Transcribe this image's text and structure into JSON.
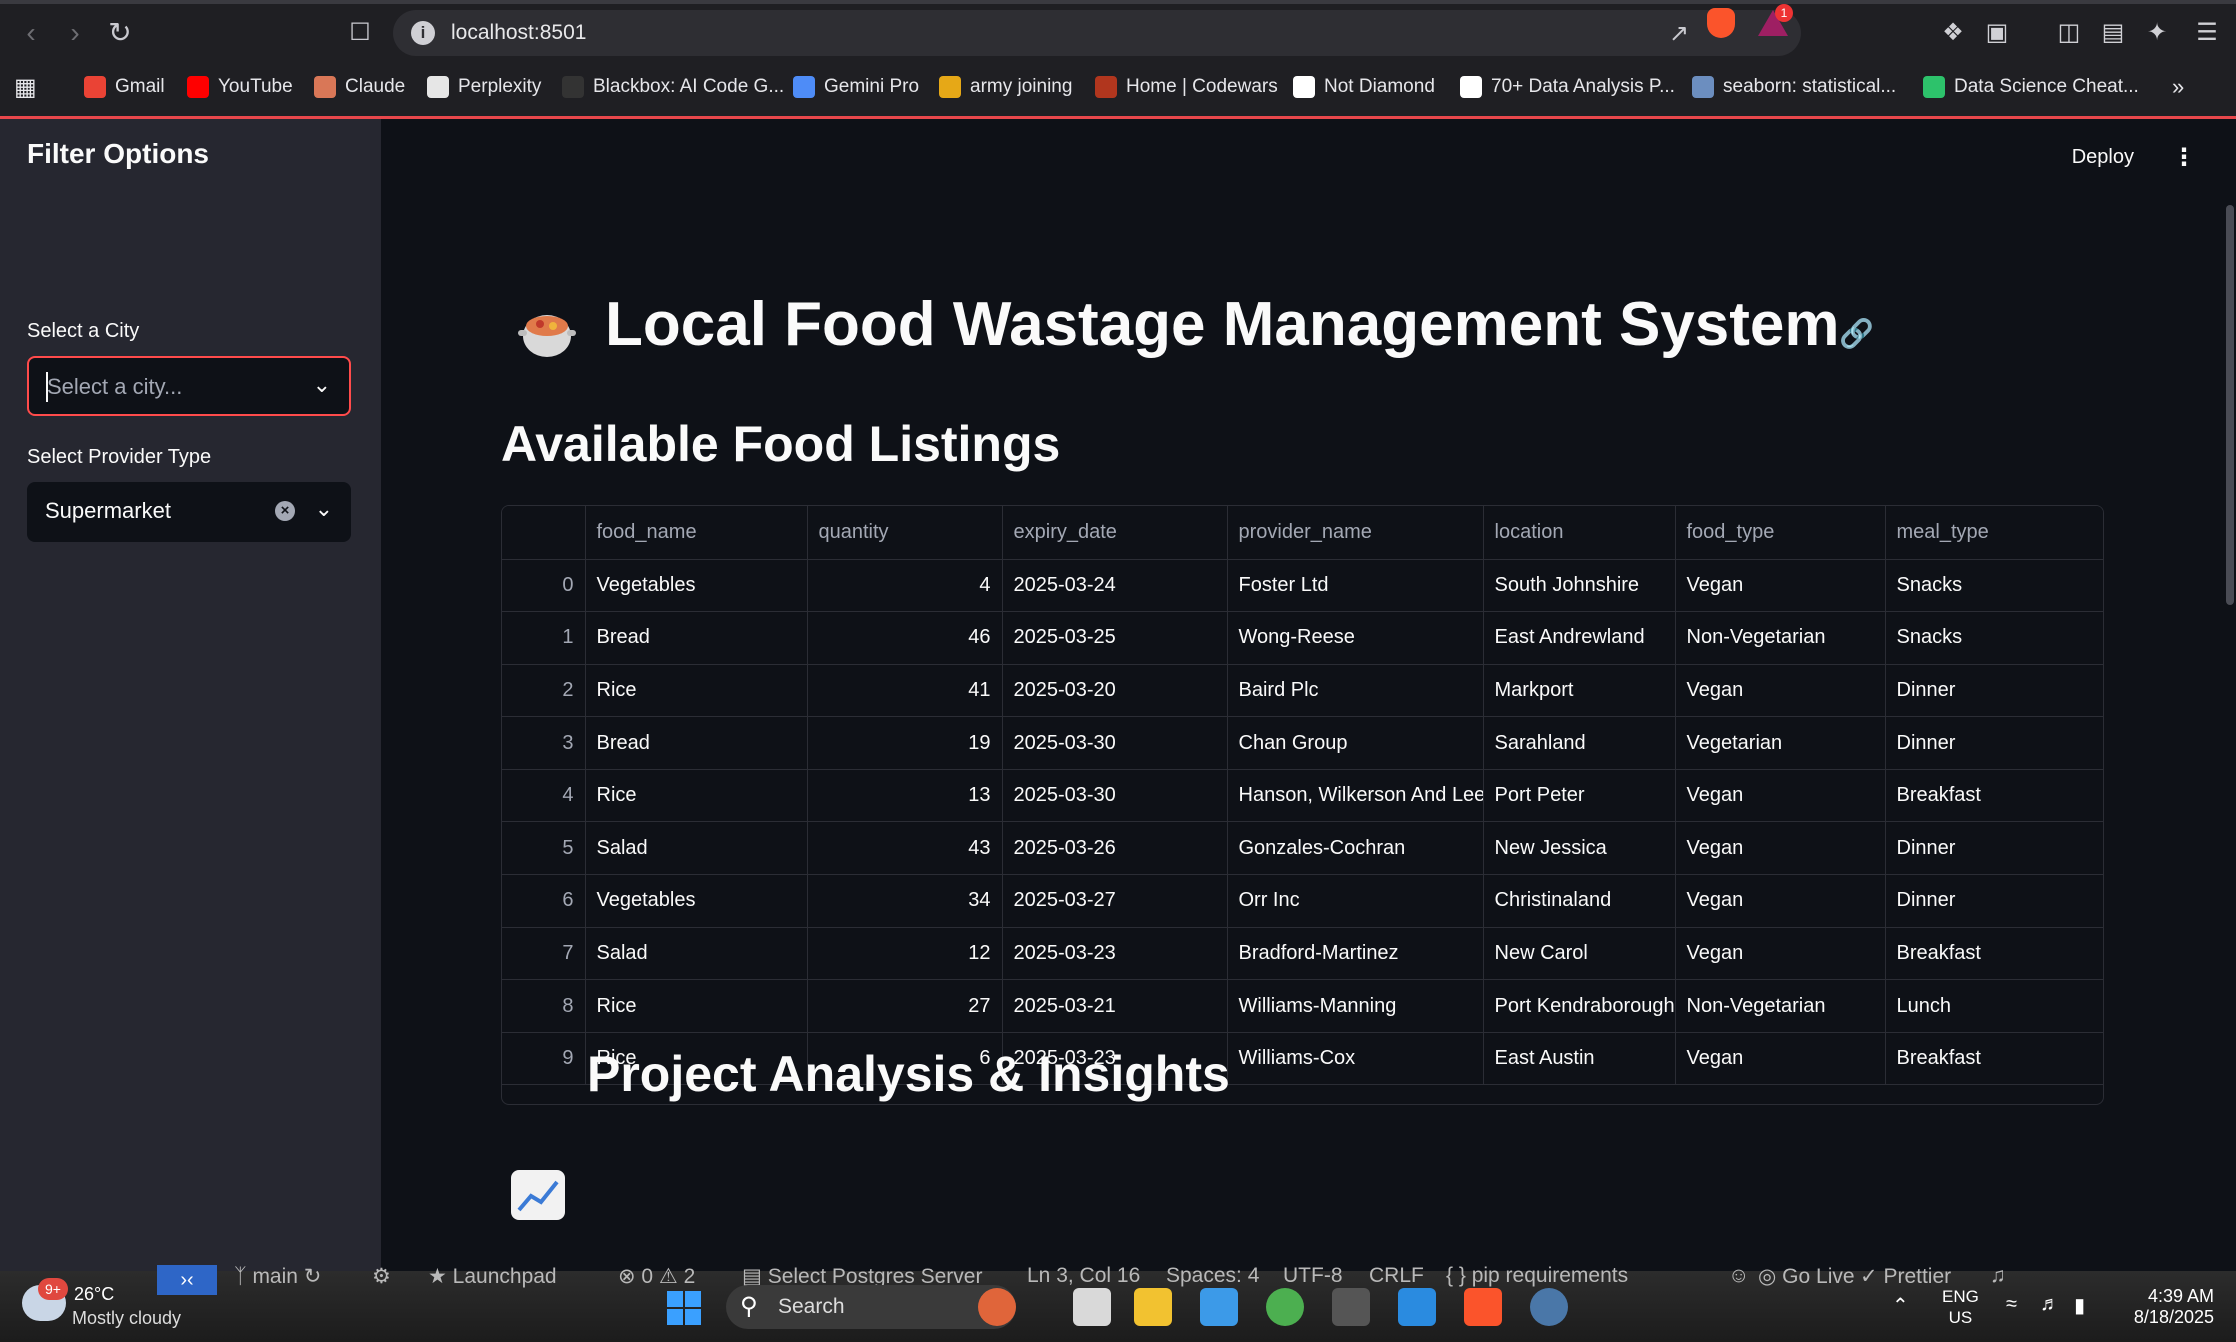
{
  "browser": {
    "url": "localhost:8501",
    "notification_count": "1",
    "bookmarks": [
      {
        "label": "Gmail",
        "color": "#ea4335"
      },
      {
        "label": "YouTube",
        "color": "#ff0000"
      },
      {
        "label": "Claude",
        "color": "#d97757"
      },
      {
        "label": "Perplexity",
        "color": "#e6e6e6"
      },
      {
        "label": "Blackbox: AI Code G...",
        "color": "#333333"
      },
      {
        "label": "Gemini Pro",
        "color": "#4e8cf7"
      },
      {
        "label": "army joining",
        "color": "#e6a817"
      },
      {
        "label": "Home | Codewars",
        "color": "#b1361e"
      },
      {
        "label": "Not Diamond",
        "color": "#ffffff"
      },
      {
        "label": "70+ Data Analysis P...",
        "color": "#ffffff"
      },
      {
        "label": "seaborn: statistical...",
        "color": "#6c8ebf"
      },
      {
        "label": "Data Science Cheat...",
        "color": "#2dc26b"
      }
    ]
  },
  "sidebar": {
    "title": "Filter Options",
    "city_label": "Select a City",
    "city_placeholder": "Select a city...",
    "provider_label": "Select Provider Type",
    "provider_value": "Supermarket"
  },
  "header": {
    "deploy_label": "Deploy"
  },
  "main": {
    "title": "Local Food Wastage Management System",
    "listings_heading": "Available Food Listings",
    "analysis_heading": "Project Analysis & Insights"
  },
  "table": {
    "columns": [
      "",
      "food_name",
      "quantity",
      "expiry_date",
      "provider_name",
      "location",
      "food_type",
      "meal_type"
    ],
    "rows": [
      [
        "0",
        "Vegetables",
        "4",
        "2025-03-24",
        "Foster Ltd",
        "South Johnshire",
        "Vegan",
        "Snacks"
      ],
      [
        "1",
        "Bread",
        "46",
        "2025-03-25",
        "Wong-Reese",
        "East Andrewland",
        "Non-Vegetarian",
        "Snacks"
      ],
      [
        "2",
        "Rice",
        "41",
        "2025-03-20",
        "Baird Plc",
        "Markport",
        "Vegan",
        "Dinner"
      ],
      [
        "3",
        "Bread",
        "19",
        "2025-03-30",
        "Chan Group",
        "Sarahland",
        "Vegetarian",
        "Dinner"
      ],
      [
        "4",
        "Rice",
        "13",
        "2025-03-30",
        "Hanson, Wilkerson And Lee",
        "Port Peter",
        "Vegan",
        "Breakfast"
      ],
      [
        "5",
        "Salad",
        "43",
        "2025-03-26",
        "Gonzales-Cochran",
        "New Jessica",
        "Vegan",
        "Dinner"
      ],
      [
        "6",
        "Vegetables",
        "34",
        "2025-03-27",
        "Orr Inc",
        "Christinaland",
        "Vegan",
        "Dinner"
      ],
      [
        "7",
        "Salad",
        "12",
        "2025-03-23",
        "Bradford-Martinez",
        "New Carol",
        "Vegan",
        "Breakfast"
      ],
      [
        "8",
        "Rice",
        "27",
        "2025-03-21",
        "Williams-Manning",
        "Port Kendraborough",
        "Non-Vegetarian",
        "Lunch"
      ],
      [
        "9",
        "Rice",
        "6",
        "2025-03-23",
        "Williams-Cox",
        "East Austin",
        "Vegan",
        "Breakfast"
      ]
    ]
  },
  "vscode_status": {
    "branch": "main",
    "launchpad": "Launchpad",
    "problems": "⊗ 0 ⚠ 2",
    "postgres": "Select Postgres Server",
    "position": "Ln 3, Col 16",
    "spaces": "Spaces: 4",
    "encoding": "UTF-8",
    "eol": "CRLF",
    "language": "{ } pip requirements",
    "golive": "Go Live",
    "prettier": "Prettier"
  },
  "taskbar": {
    "weather_badge": "9+",
    "temperature": "26°C",
    "weather": "Mostly cloudy",
    "search_placeholder": "Search",
    "lang_top": "ENG",
    "lang_bottom": "US",
    "time": "4:39 AM",
    "date": "8/18/2025"
  }
}
